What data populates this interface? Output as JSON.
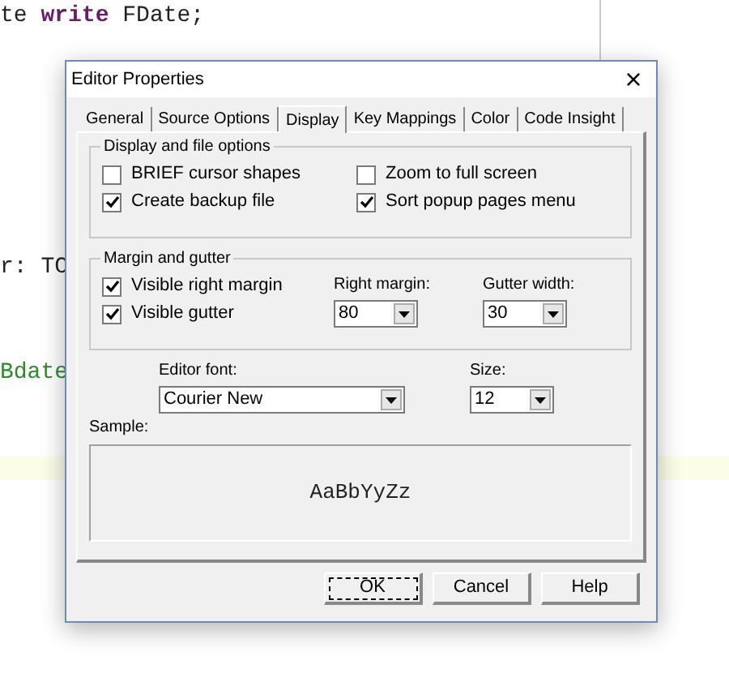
{
  "editor": {
    "lines": [
      [
        {
          "text": "te ",
          "kind": "plain"
        },
        {
          "text": "write",
          "kind": "keyword"
        },
        {
          "text": " FDate;",
          "kind": "plain"
        }
      ],
      [
        {
          "text": "r: TC",
          "kind": "plain"
        }
      ],
      [
        {
          "text": "Bdate",
          "kind": "identifier"
        }
      ]
    ]
  },
  "dialog": {
    "title": "Editor Properties",
    "close": "×",
    "tabs": [
      {
        "label": "General",
        "selected": false
      },
      {
        "label": "Source Options",
        "selected": false
      },
      {
        "label": "Display",
        "selected": true
      },
      {
        "label": "Key Mappings",
        "selected": false
      },
      {
        "label": "Color",
        "selected": false
      },
      {
        "label": "Code Insight",
        "selected": false
      }
    ],
    "display_group": {
      "title": "Display and file options",
      "options": [
        {
          "label": "BRIEF cursor shapes",
          "checked": false
        },
        {
          "label": "Zoom to full screen",
          "checked": false
        },
        {
          "label": "Create backup file",
          "checked": true
        },
        {
          "label": "Sort popup pages menu",
          "checked": true
        }
      ]
    },
    "margin_group": {
      "title": "Margin and gutter",
      "options": [
        {
          "label": "Visible right margin",
          "checked": true
        },
        {
          "label": "Visible gutter",
          "checked": true
        }
      ],
      "right_margin": {
        "label": "Right margin:",
        "value": "80"
      },
      "gutter_width": {
        "label": "Gutter width:",
        "value": "30"
      }
    },
    "editor_font": {
      "label": "Editor font:",
      "value": "Courier New"
    },
    "size": {
      "label": "Size:",
      "value": "12"
    },
    "sample": {
      "label": "Sample:",
      "text": "AaBbYyZz"
    },
    "buttons": [
      {
        "label": "OK",
        "default": true
      },
      {
        "label": "Cancel",
        "default": false
      },
      {
        "label": "Help",
        "default": false
      }
    ]
  }
}
